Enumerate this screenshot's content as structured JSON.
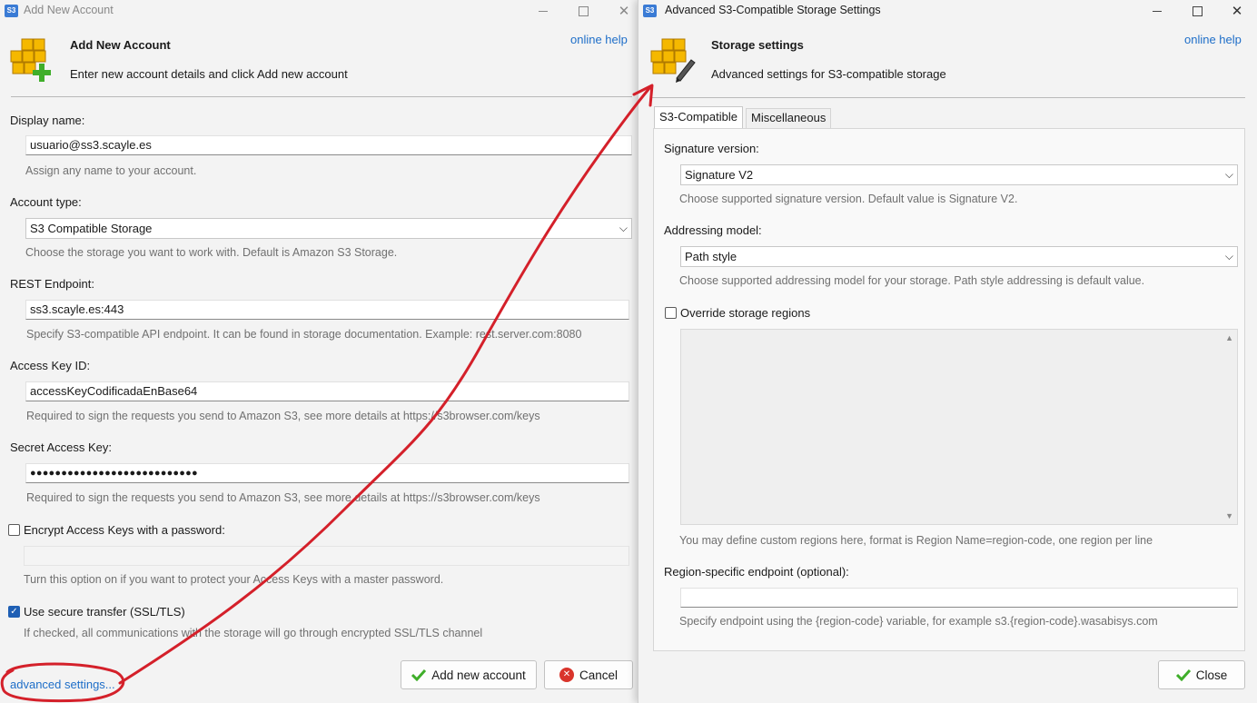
{
  "left_window": {
    "title": "Add New Account",
    "online_help": "online help",
    "header_title": "Add New Account",
    "header_subtitle": "Enter new account details and click Add new account",
    "display_name": {
      "label": "Display name:",
      "value": "usuario@ss3.scayle.es",
      "hint": "Assign any name to your account."
    },
    "account_type": {
      "label": "Account type:",
      "value": "S3 Compatible Storage",
      "hint": "Choose the storage you want to work with. Default is Amazon S3 Storage."
    },
    "rest_endpoint": {
      "label": "REST Endpoint:",
      "value": "ss3.scayle.es:443",
      "hint": "Specify S3-compatible API endpoint. It can be found in storage documentation. Example: rest.server.com:8080"
    },
    "access_key": {
      "label": "Access Key ID:",
      "value": "accessKeyCodificadaEnBase64",
      "hint": "Required to sign the requests you send to Amazon S3, see more details at https://s3browser.com/keys"
    },
    "secret_key": {
      "label": "Secret Access Key:",
      "value": "●●●●●●●●●●●●●●●●●●●●●●●●●●●",
      "hint": "Required to sign the requests you send to Amazon S3, see more details at https://s3browser.com/keys"
    },
    "encrypt": {
      "label": "Encrypt Access Keys with a password:",
      "checked": false,
      "hint": "Turn this option on if you want to protect your Access Keys with a master password."
    },
    "ssl": {
      "label": "Use secure transfer (SSL/TLS)",
      "checked": true,
      "hint": "If checked, all communications with the storage will go through encrypted SSL/TLS channel"
    },
    "advanced_link": "advanced settings...",
    "add_button": "Add new account",
    "cancel_button": "Cancel"
  },
  "right_window": {
    "title": "Advanced S3-Compatible Storage Settings",
    "online_help": "online help",
    "header_title": "Storage settings",
    "header_subtitle": "Advanced settings for S3-compatible storage",
    "tabs": [
      "S3-Compatible",
      "Miscellaneous"
    ],
    "active_tab": "S3-Compatible",
    "signature": {
      "label": "Signature version:",
      "value": "Signature V2",
      "hint": "Choose supported signature version. Default value is Signature V2."
    },
    "addressing": {
      "label": "Addressing model:",
      "value": "Path style",
      "hint": "Choose supported addressing model for your storage. Path style addressing is default value."
    },
    "override_regions": {
      "label": "Override storage regions",
      "checked": false,
      "hint": "You may define custom regions here, format is Region Name=region-code, one region per line"
    },
    "region_endpoint": {
      "label": "Region-specific endpoint (optional):",
      "value": "",
      "hint": "Specify endpoint using the {region-code} variable, for example s3.{region-code}.wasabisys.com"
    },
    "close_button": "Close"
  },
  "app_icon_text": "S3",
  "colors": {
    "link": "#1e6ec8",
    "annotation": "#d4202a",
    "checkbox": "#1e5fb4",
    "box_yellow": "#f5b800"
  }
}
